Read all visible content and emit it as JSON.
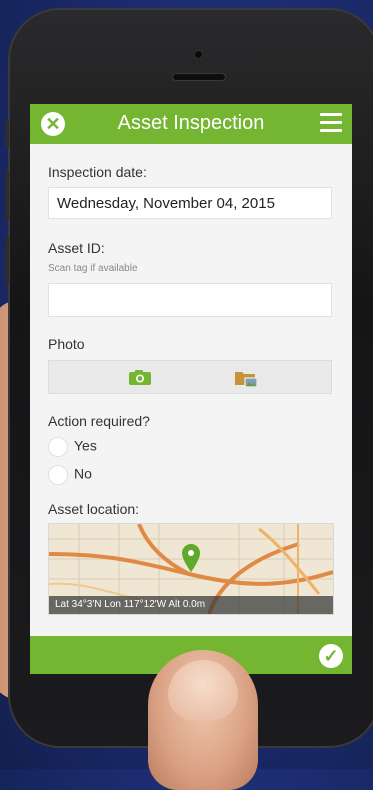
{
  "header": {
    "title": "Asset Inspection",
    "close_glyph": "✕",
    "menu_icon": "hamburger-icon"
  },
  "form": {
    "inspection_date": {
      "label": "Inspection date:",
      "value": "Wednesday, November 04, 2015"
    },
    "asset_id": {
      "label": "Asset ID:",
      "hint": "Scan tag if available",
      "value": ""
    },
    "photo": {
      "label": "Photo",
      "buttons": [
        "camera-icon",
        "folder-icon"
      ]
    },
    "action_required": {
      "label": "Action required?",
      "options": [
        "Yes",
        "No"
      ]
    },
    "asset_location": {
      "label": "Asset location:",
      "coords": "Lat 34°3'N Lon 117°12'W Alt 0.0m"
    }
  },
  "footer": {
    "submit_glyph": "✓"
  },
  "colors": {
    "accent": "#74b531",
    "background": "#f4f4f4"
  }
}
